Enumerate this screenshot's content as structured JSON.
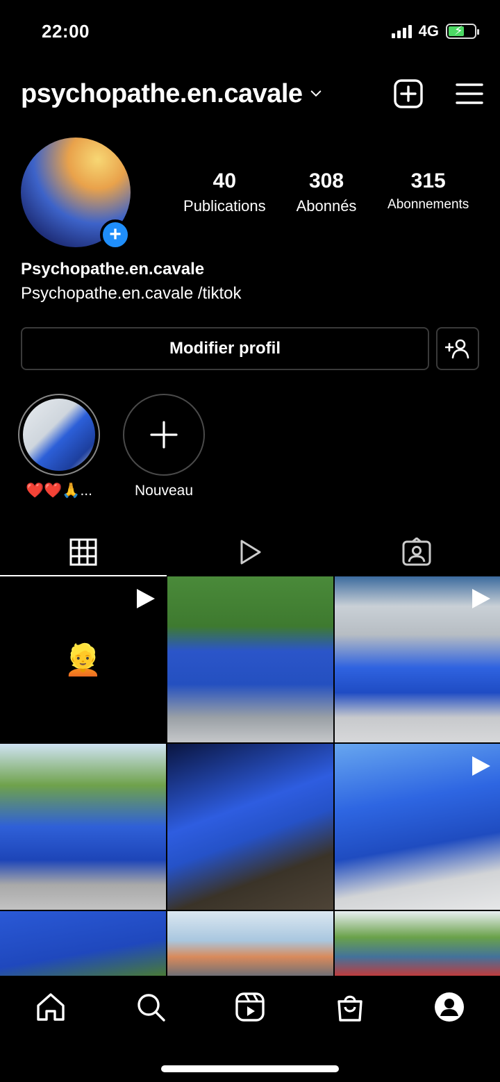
{
  "status_bar": {
    "time": "22:00",
    "network": "4G"
  },
  "header": {
    "username": "psychopathe.en.cavale"
  },
  "profile": {
    "stats": [
      {
        "value": "40",
        "label": "Publications"
      },
      {
        "value": "308",
        "label": "Abonnés"
      },
      {
        "value": "315",
        "label": "Abonnements"
      }
    ],
    "display_name": "Psychopathe.en.cavale",
    "bio": "Psychopathe.en.cavale /tiktok",
    "edit_button": "Modifier profil"
  },
  "highlights": [
    {
      "label": "❤️❤️🙏..."
    },
    {
      "label": "Nouveau"
    }
  ],
  "grid": {
    "first_post_emoji": "👱"
  },
  "colors": {
    "accent": "#1f8efa",
    "background": "#000000"
  }
}
